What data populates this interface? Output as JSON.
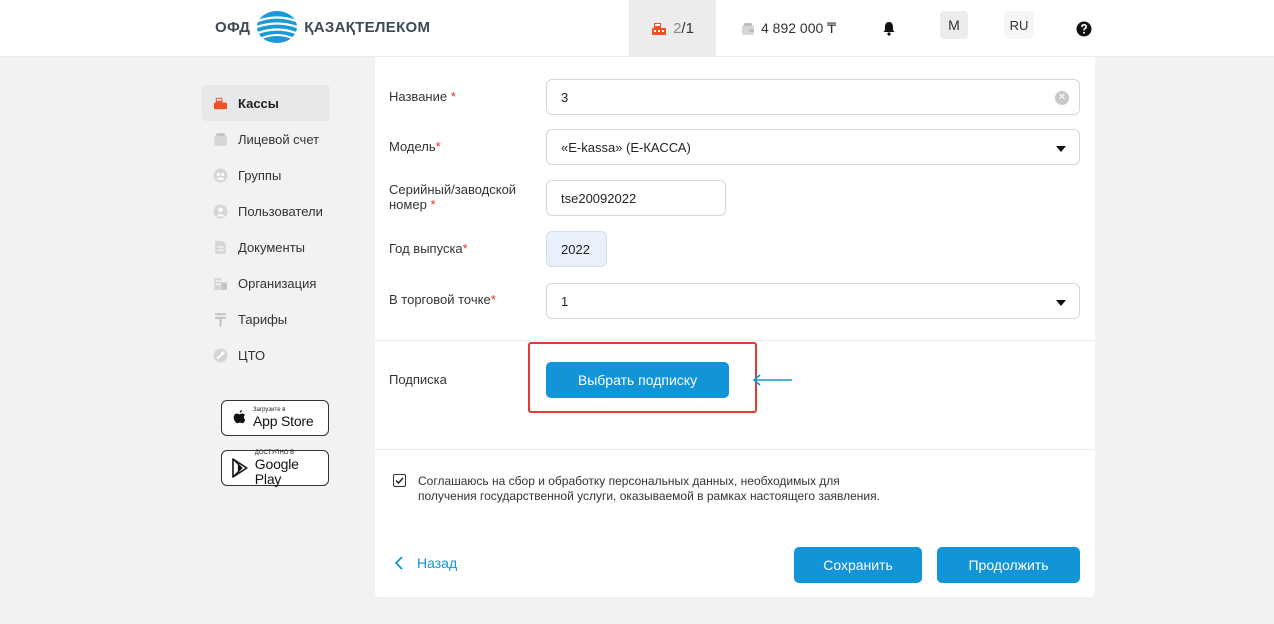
{
  "header": {
    "logo_left": "ОФД",
    "logo_right": "ҚАЗАҚТЕЛЕКОМ",
    "kassa_count_current": "2",
    "kassa_count_total": "/1",
    "balance": "4 892 000 ₸",
    "avatar_letter": "M",
    "language": "RU",
    "icons": [
      "cash-register-icon",
      "wallet-icon",
      "bell-icon",
      "help-icon"
    ]
  },
  "sidebar": {
    "items": [
      {
        "label": "Кассы",
        "icon": "cash-register-icon",
        "active": true
      },
      {
        "label": "Лицевой счет",
        "icon": "wallet-icon"
      },
      {
        "label": "Группы",
        "icon": "groups-icon"
      },
      {
        "label": "Пользователи",
        "icon": "user-icon"
      },
      {
        "label": "Документы",
        "icon": "document-icon"
      },
      {
        "label": "Организация",
        "icon": "building-icon"
      },
      {
        "label": "Тарифы",
        "icon": "tenge-icon"
      },
      {
        "label": "ЦТО",
        "icon": "wrench-icon"
      }
    ],
    "app_store": {
      "small": "Загрузите в",
      "big": "App Store"
    },
    "google_play": {
      "small": "ДОСТУПНО В",
      "big": "Google Play"
    }
  },
  "form": {
    "name": {
      "label": "Название",
      "value": "3"
    },
    "model": {
      "label": "Модель",
      "value": "«E-kassa» (E-КАССА)"
    },
    "serial": {
      "label_line1": "Серийный/заводской",
      "label_line2": "номер",
      "value": "tse20092022"
    },
    "year": {
      "label": "Год выпуска",
      "value": "2022"
    },
    "point": {
      "label": "В торговой точке",
      "value": "1"
    },
    "required_mark": "*",
    "subscription": {
      "label": "Подписка",
      "button": "Выбрать подписку"
    },
    "consent": {
      "checked": true,
      "text": "Соглашаюсь на сбор и обработку персональных данных, необходимых для получения государственной услуги, оказываемой в рамках настоящего заявления."
    },
    "back_label": "Назад",
    "save_label": "Сохранить",
    "continue_label": "Продолжить"
  },
  "colors": {
    "accent": "#1194d8",
    "required": "#e03030",
    "highlight": "#e53935",
    "kassa_icon": "#f04e23"
  }
}
